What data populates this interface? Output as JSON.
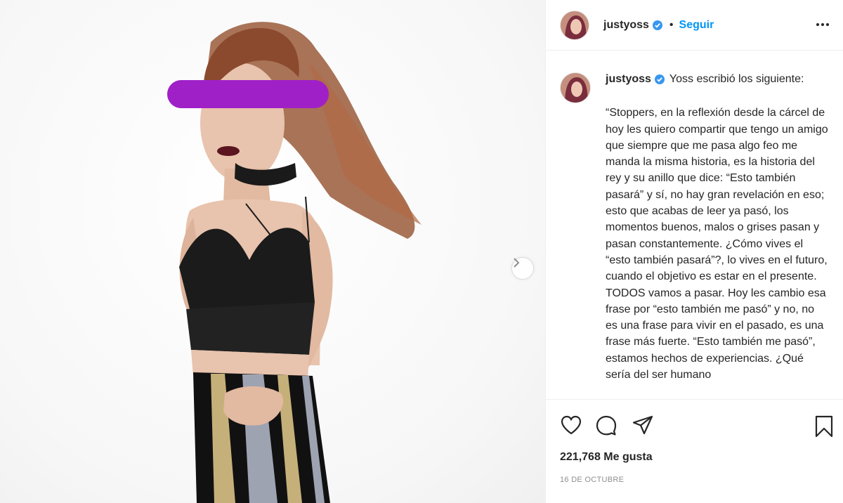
{
  "post": {
    "username": "justyoss",
    "follow_label": "Seguir",
    "separator": "•",
    "caption_intro": "Yoss escribió los siguiente:",
    "caption_text": "“Stoppers, en la reflexión desde la cárcel de hoy les quiero compartir que tengo un amigo que siempre que me pasa algo feo me manda la misma historia, es la historia del rey y su anillo que dice: “Esto también pasará” y sí, no hay gran revelación en eso; esto que acabas de leer ya pasó, los momentos buenos, malos o grises pasan y pasan constantemente. ¿Cómo vives el “esto también pasará”?, lo vives en el futuro, cuando el objetivo es estar en el presente. TODOS vamos a pasar. Hoy les cambio esa frase por “esto también me pasó” y no, no es una frase para vivir en el pasado, es una frase más fuerte. “Esto también me pasó”, estamos hechos de experiencias. ¿Qué sería del ser humano",
    "likes": "221,768 Me gusta",
    "date": "16 DE OCTUBRE"
  },
  "icons": {
    "verified": "verified-badge-icon",
    "more": "more-options-icon",
    "like": "heart-icon",
    "comment": "comment-icon",
    "share": "paper-plane-icon",
    "save": "bookmark-icon",
    "next": "chevron-right-icon"
  },
  "colors": {
    "accent": "#0095f6",
    "verified": "#3897f0",
    "censor_bar": "#a020c8",
    "text": "#262626",
    "muted": "#8e8e8e"
  }
}
